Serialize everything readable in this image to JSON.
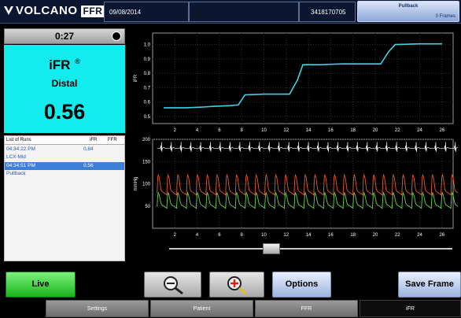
{
  "header": {
    "brand": "VOLCANO",
    "product": "FFR",
    "date": "09/08/2014",
    "patient_id": "3418170705",
    "mode": {
      "title": "Pullback",
      "frames": "0 Frames"
    }
  },
  "timer": "0:27",
  "measurement": {
    "label": "iFR",
    "reg_mark": "®",
    "location": "Distal",
    "value": "0.56"
  },
  "runs": {
    "header": {
      "title": "List of Runs",
      "col_ifr": "iFR",
      "col_ffr": "FFR"
    },
    "items": [
      {
        "time": "04:34:22 PM",
        "ifr": "0.84",
        "ffr": "",
        "note": "LCX Mid",
        "selected": false
      },
      {
        "time": "04:34:51 PM",
        "ifr": "0.56",
        "ffr": "",
        "note": "Pullback",
        "selected": true
      }
    ]
  },
  "chart_data": [
    {
      "type": "line",
      "ylabel": "iFR",
      "xlim": [
        0,
        27
      ],
      "ylim": [
        0.45,
        1.08
      ],
      "yticks": [
        0.5,
        0.6,
        0.7,
        0.8,
        0.9,
        1.0
      ],
      "xticks": [
        2,
        4,
        6,
        8,
        10,
        12,
        14,
        16,
        18,
        20,
        22,
        24,
        26
      ],
      "grid": true,
      "series": [
        {
          "color": "#41d3e4",
          "x": [
            1.0,
            3.0,
            4.5,
            5.5,
            7.0,
            7.7,
            8.3,
            10.0,
            12.3,
            13.0,
            13.5,
            15.0,
            17.0,
            20.5,
            21.2,
            21.8,
            24.0,
            26.0
          ],
          "y": [
            0.56,
            0.56,
            0.565,
            0.57,
            0.575,
            0.58,
            0.65,
            0.655,
            0.655,
            0.75,
            0.86,
            0.86,
            0.865,
            0.865,
            0.95,
            1.0,
            1.005,
            1.005
          ]
        }
      ]
    },
    {
      "type": "line",
      "ylabel": "mmHg",
      "xlim": [
        0,
        27
      ],
      "ylim": [
        0,
        200
      ],
      "yticks": [
        50,
        100,
        150,
        200
      ],
      "xticks": [
        2,
        4,
        6,
        8,
        10,
        12,
        14,
        16,
        18,
        20,
        22,
        24,
        26
      ],
      "grid": true,
      "series": [
        {
          "color": "#f0f0f0",
          "kind": "ecg",
          "baseline": 180
        },
        {
          "color": "#e65a2a",
          "kind": "aortic",
          "systolic": 120,
          "diastolic": 75
        },
        {
          "color": "#6bd44a",
          "kind": "distal",
          "systolic": 80,
          "diastolic": 45
        }
      ]
    }
  ],
  "slider_fraction": 0.36,
  "buttons": {
    "live": "Live",
    "options": "Options",
    "save_frame": "Save Frame"
  },
  "tabs": [
    "Settings",
    "Patient",
    "FFR",
    "iFR"
  ],
  "active_tab": "iFR",
  "colors": {
    "ifr_panel": "#12ecef",
    "live": "#2cc42c",
    "header": "#0b1730"
  }
}
